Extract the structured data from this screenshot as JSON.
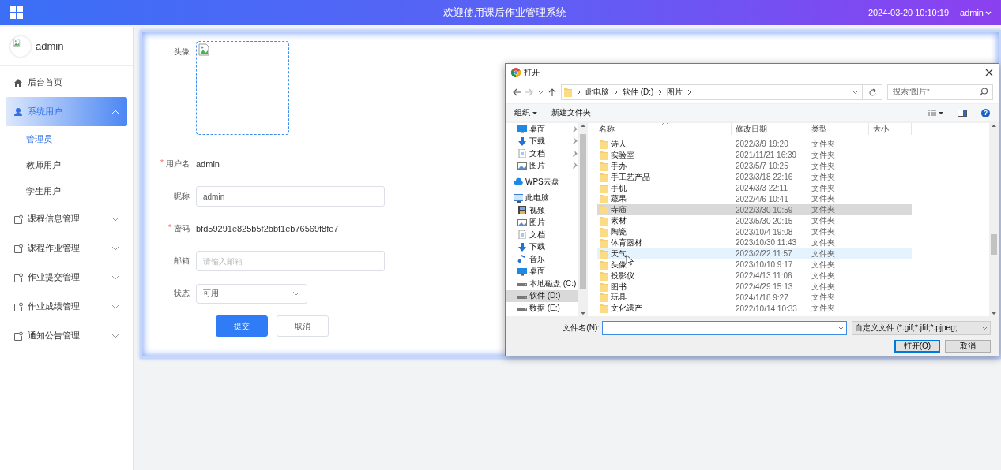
{
  "header": {
    "title": "欢迎使用课后作业管理系统",
    "datetime": "2024-03-20 10:10:19",
    "user": "admin"
  },
  "sidebar": {
    "user_name": "admin",
    "items": [
      {
        "label": "后台首页",
        "kind": "link",
        "selected": false
      },
      {
        "label": "系统用户",
        "kind": "group",
        "selected": true,
        "expanded": true,
        "children": [
          {
            "label": "管理员",
            "selected": true
          },
          {
            "label": "教师用户",
            "selected": false
          },
          {
            "label": "学生用户",
            "selected": false
          }
        ]
      },
      {
        "label": "课程信息管理",
        "kind": "group",
        "selected": false,
        "expanded": false
      },
      {
        "label": "课程作业管理",
        "kind": "group",
        "selected": false,
        "expanded": false
      },
      {
        "label": "作业提交管理",
        "kind": "group",
        "selected": false,
        "expanded": false
      },
      {
        "label": "作业成绩管理",
        "kind": "group",
        "selected": false,
        "expanded": false
      },
      {
        "label": "通知公告管理",
        "kind": "group",
        "selected": false,
        "expanded": false
      }
    ]
  },
  "form": {
    "fields": [
      {
        "kind": "avatar",
        "label": "头像"
      },
      {
        "kind": "text",
        "label": "用户名",
        "marker": "*",
        "value": "admin"
      },
      {
        "kind": "input",
        "label": "昵称",
        "value": "admin"
      },
      {
        "kind": "text",
        "label": "密码",
        "marker": "*",
        "value": "bfd59291e825b5f2bbf1eb76569f8fe7"
      },
      {
        "kind": "input",
        "label": "邮箱",
        "placeholder": "请输入邮箱"
      },
      {
        "kind": "select",
        "label": "状态",
        "value": "可用"
      }
    ],
    "buttons": [
      {
        "label": "提交",
        "primary": true
      },
      {
        "label": "取消",
        "primary": false
      }
    ]
  },
  "dialog": {
    "title": "打开",
    "path": [
      "此电脑",
      "软件 (D:)",
      "图片"
    ],
    "search": {
      "placeholder": "搜索\"图片\""
    },
    "toolbar": {
      "organize": "组织",
      "new_folder": "新建文件夹",
      "help": "?"
    },
    "quick_access": [
      {
        "label": "桌面",
        "pinned": true
      },
      {
        "label": "下载",
        "pinned": true
      },
      {
        "label": "文档",
        "pinned": true
      },
      {
        "label": "图片",
        "pinned": true
      }
    ],
    "locations": [
      {
        "label": "WPS云盘",
        "selected": false
      },
      {
        "label": "此电脑",
        "selected": false,
        "children": [
          {
            "label": "视频",
            "selected": false
          },
          {
            "label": "图片",
            "selected": false
          },
          {
            "label": "文档",
            "selected": false
          },
          {
            "label": "下载",
            "selected": false
          },
          {
            "label": "音乐",
            "selected": false
          },
          {
            "label": "桌面",
            "selected": false
          },
          {
            "label": "本地磁盘 (C:)",
            "selected": false
          },
          {
            "label": "软件 (D:)",
            "selected": true
          },
          {
            "label": "数据 (E:)",
            "selected": false
          }
        ]
      }
    ],
    "columns": [
      "名称",
      "修改日期",
      "类型",
      "大小"
    ],
    "files": [
      {
        "name": "诗人",
        "modified": "2022/3/9 19:20",
        "type": "文件夹",
        "selected": false,
        "hovered": false
      },
      {
        "name": "实验室",
        "modified": "2021/11/21 16:39",
        "type": "文件夹",
        "selected": false,
        "hovered": false
      },
      {
        "name": "手办",
        "modified": "2023/5/7 10:25",
        "type": "文件夹",
        "selected": false,
        "hovered": false
      },
      {
        "name": "手工艺产品",
        "modified": "2023/3/18 22:16",
        "type": "文件夹",
        "selected": false,
        "hovered": false
      },
      {
        "name": "手机",
        "modified": "2024/3/3 22:11",
        "type": "文件夹",
        "selected": false,
        "hovered": false
      },
      {
        "name": "蔬果",
        "modified": "2022/4/6 10:41",
        "type": "文件夹",
        "selected": false,
        "hovered": false
      },
      {
        "name": "寺庙",
        "modified": "2022/3/30 10:59",
        "type": "文件夹",
        "selected": true,
        "hovered": false
      },
      {
        "name": "素材",
        "modified": "2023/5/30 20:15",
        "type": "文件夹",
        "selected": false,
        "hovered": false
      },
      {
        "name": "陶瓷",
        "modified": "2023/10/4 19:08",
        "type": "文件夹",
        "selected": false,
        "hovered": false
      },
      {
        "name": "体育器材",
        "modified": "2023/10/30 11:43",
        "type": "文件夹",
        "selected": false,
        "hovered": false
      },
      {
        "name": "天气",
        "modified": "2023/2/22 11:57",
        "type": "文件夹",
        "selected": false,
        "hovered": true
      },
      {
        "name": "头像",
        "modified": "2023/10/10 9:17",
        "type": "文件夹",
        "selected": false,
        "hovered": false
      },
      {
        "name": "投影仪",
        "modified": "2022/4/13 11:06",
        "type": "文件夹",
        "selected": false,
        "hovered": false
      },
      {
        "name": "图书",
        "modified": "2022/4/29 15:13",
        "type": "文件夹",
        "selected": false,
        "hovered": false
      },
      {
        "name": "玩具",
        "modified": "2024/1/18 9:27",
        "type": "文件夹",
        "selected": false,
        "hovered": false
      },
      {
        "name": "文化遗产",
        "modified": "2022/10/14 10:33",
        "type": "文件夹",
        "selected": false,
        "hovered": false
      }
    ],
    "filename_label": "文件名(N):",
    "filetype": "自定义文件 (*.gif;*.jfif;*.pjpeg;",
    "buttons": [
      {
        "label": "打开(O)",
        "default": true
      },
      {
        "label": "取消",
        "default": false
      }
    ]
  }
}
